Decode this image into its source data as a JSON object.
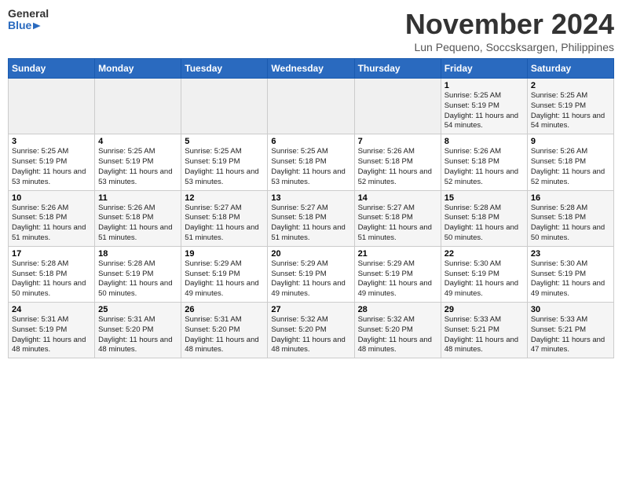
{
  "header": {
    "logo_general": "General",
    "logo_blue": "Blue",
    "month_year": "November 2024",
    "location": "Lun Pequeno, Soccsksargen, Philippines"
  },
  "days_of_week": [
    "Sunday",
    "Monday",
    "Tuesday",
    "Wednesday",
    "Thursday",
    "Friday",
    "Saturday"
  ],
  "weeks": [
    [
      {
        "day": "",
        "info": ""
      },
      {
        "day": "",
        "info": ""
      },
      {
        "day": "",
        "info": ""
      },
      {
        "day": "",
        "info": ""
      },
      {
        "day": "",
        "info": ""
      },
      {
        "day": "1",
        "info": "Sunrise: 5:25 AM\nSunset: 5:19 PM\nDaylight: 11 hours\nand 54 minutes."
      },
      {
        "day": "2",
        "info": "Sunrise: 5:25 AM\nSunset: 5:19 PM\nDaylight: 11 hours\nand 54 minutes."
      }
    ],
    [
      {
        "day": "3",
        "info": "Sunrise: 5:25 AM\nSunset: 5:19 PM\nDaylight: 11 hours\nand 53 minutes."
      },
      {
        "day": "4",
        "info": "Sunrise: 5:25 AM\nSunset: 5:19 PM\nDaylight: 11 hours\nand 53 minutes."
      },
      {
        "day": "5",
        "info": "Sunrise: 5:25 AM\nSunset: 5:19 PM\nDaylight: 11 hours\nand 53 minutes."
      },
      {
        "day": "6",
        "info": "Sunrise: 5:25 AM\nSunset: 5:18 PM\nDaylight: 11 hours\nand 53 minutes."
      },
      {
        "day": "7",
        "info": "Sunrise: 5:26 AM\nSunset: 5:18 PM\nDaylight: 11 hours\nand 52 minutes."
      },
      {
        "day": "8",
        "info": "Sunrise: 5:26 AM\nSunset: 5:18 PM\nDaylight: 11 hours\nand 52 minutes."
      },
      {
        "day": "9",
        "info": "Sunrise: 5:26 AM\nSunset: 5:18 PM\nDaylight: 11 hours\nand 52 minutes."
      }
    ],
    [
      {
        "day": "10",
        "info": "Sunrise: 5:26 AM\nSunset: 5:18 PM\nDaylight: 11 hours\nand 51 minutes."
      },
      {
        "day": "11",
        "info": "Sunrise: 5:26 AM\nSunset: 5:18 PM\nDaylight: 11 hours\nand 51 minutes."
      },
      {
        "day": "12",
        "info": "Sunrise: 5:27 AM\nSunset: 5:18 PM\nDaylight: 11 hours\nand 51 minutes."
      },
      {
        "day": "13",
        "info": "Sunrise: 5:27 AM\nSunset: 5:18 PM\nDaylight: 11 hours\nand 51 minutes."
      },
      {
        "day": "14",
        "info": "Sunrise: 5:27 AM\nSunset: 5:18 PM\nDaylight: 11 hours\nand 51 minutes."
      },
      {
        "day": "15",
        "info": "Sunrise: 5:28 AM\nSunset: 5:18 PM\nDaylight: 11 hours\nand 50 minutes."
      },
      {
        "day": "16",
        "info": "Sunrise: 5:28 AM\nSunset: 5:18 PM\nDaylight: 11 hours\nand 50 minutes."
      }
    ],
    [
      {
        "day": "17",
        "info": "Sunrise: 5:28 AM\nSunset: 5:18 PM\nDaylight: 11 hours\nand 50 minutes."
      },
      {
        "day": "18",
        "info": "Sunrise: 5:28 AM\nSunset: 5:19 PM\nDaylight: 11 hours\nand 50 minutes."
      },
      {
        "day": "19",
        "info": "Sunrise: 5:29 AM\nSunset: 5:19 PM\nDaylight: 11 hours\nand 49 minutes."
      },
      {
        "day": "20",
        "info": "Sunrise: 5:29 AM\nSunset: 5:19 PM\nDaylight: 11 hours\nand 49 minutes."
      },
      {
        "day": "21",
        "info": "Sunrise: 5:29 AM\nSunset: 5:19 PM\nDaylight: 11 hours\nand 49 minutes."
      },
      {
        "day": "22",
        "info": "Sunrise: 5:30 AM\nSunset: 5:19 PM\nDaylight: 11 hours\nand 49 minutes."
      },
      {
        "day": "23",
        "info": "Sunrise: 5:30 AM\nSunset: 5:19 PM\nDaylight: 11 hours\nand 49 minutes."
      }
    ],
    [
      {
        "day": "24",
        "info": "Sunrise: 5:31 AM\nSunset: 5:19 PM\nDaylight: 11 hours\nand 48 minutes."
      },
      {
        "day": "25",
        "info": "Sunrise: 5:31 AM\nSunset: 5:20 PM\nDaylight: 11 hours\nand 48 minutes."
      },
      {
        "day": "26",
        "info": "Sunrise: 5:31 AM\nSunset: 5:20 PM\nDaylight: 11 hours\nand 48 minutes."
      },
      {
        "day": "27",
        "info": "Sunrise: 5:32 AM\nSunset: 5:20 PM\nDaylight: 11 hours\nand 48 minutes."
      },
      {
        "day": "28",
        "info": "Sunrise: 5:32 AM\nSunset: 5:20 PM\nDaylight: 11 hours\nand 48 minutes."
      },
      {
        "day": "29",
        "info": "Sunrise: 5:33 AM\nSunset: 5:21 PM\nDaylight: 11 hours\nand 48 minutes."
      },
      {
        "day": "30",
        "info": "Sunrise: 5:33 AM\nSunset: 5:21 PM\nDaylight: 11 hours\nand 47 minutes."
      }
    ]
  ]
}
